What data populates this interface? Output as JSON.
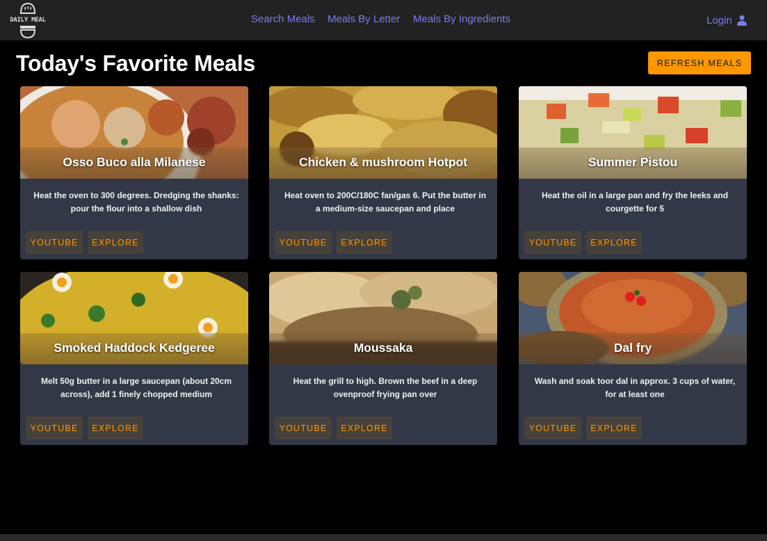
{
  "brand": {
    "logo_text": "DAILY MEAL"
  },
  "nav": {
    "links": [
      {
        "label": "Search Meals"
      },
      {
        "label": "Meals By Letter"
      },
      {
        "label": "Meals By Ingredients"
      }
    ],
    "login_label": "Login",
    "link_color": "#7b7bf0"
  },
  "header": {
    "title": "Today's Favorite Meals",
    "refresh_label": "REFRESH MEALS",
    "accent": "#ff9800"
  },
  "meals": [
    {
      "name": "Osso Buco alla Milanese",
      "description": "Heat the oven to 300 degrees. Dredging the shanks: pour the flour into a shallow dish",
      "youtube_label": "YOUTUBE",
      "explore_label": "EXPLORE"
    },
    {
      "name": "Chicken & mushroom Hotpot",
      "description": "Heat oven to 200C/180C fan/gas 6. Put the butter in a medium-size saucepan and place",
      "youtube_label": "YOUTUBE",
      "explore_label": "EXPLORE"
    },
    {
      "name": "Summer Pistou",
      "description": "Heat the oil in a large pan and fry the leeks and courgette for 5",
      "youtube_label": "YOUTUBE",
      "explore_label": "EXPLORE"
    },
    {
      "name": "Smoked Haddock Kedgeree",
      "description": "Melt 50g butter in a large saucepan (about 20cm across), add 1 finely chopped medium",
      "youtube_label": "YOUTUBE",
      "explore_label": "EXPLORE"
    },
    {
      "name": "Moussaka",
      "description": "Heat the grill to high. Brown the beef in a deep ovenproof frying pan over",
      "youtube_label": "YOUTUBE",
      "explore_label": "EXPLORE"
    },
    {
      "name": "Dal fry",
      "description": "Wash and soak toor dal in approx. 3 cups of water, for at least one",
      "youtube_label": "YOUTUBE",
      "explore_label": "EXPLORE"
    }
  ]
}
